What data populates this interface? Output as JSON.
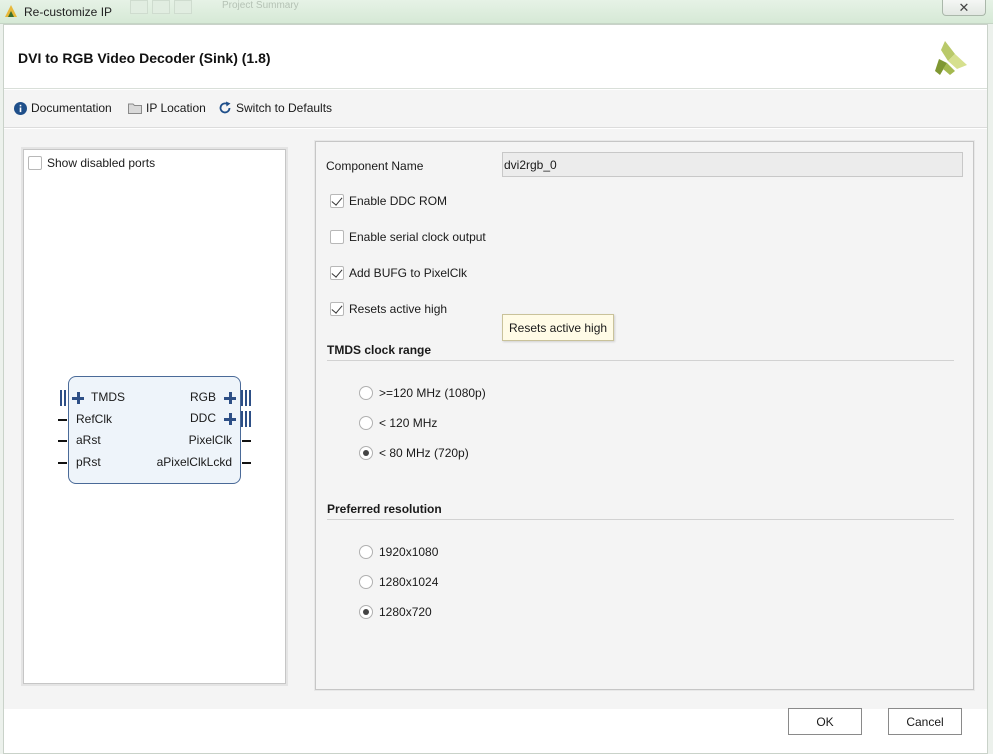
{
  "window": {
    "title": "Re-customize IP",
    "background_tab_text": "Project Summary",
    "close_glyph": "✕"
  },
  "header": {
    "heading": "DVI to RGB Video Decoder (Sink) (1.8)",
    "logo_icon": "xilinx-logo-icon",
    "logo_color": "#8fa33a"
  },
  "toolbar": {
    "documentation": "Documentation",
    "ip_location": "IP Location",
    "switch_defaults": "Switch to Defaults",
    "accent_color": "#1f4f8a"
  },
  "left_panel": {
    "show_disabled_ports": "Show disabled ports",
    "show_disabled_ports_checked": false,
    "block": {
      "left_ports": [
        "TMDS",
        "RefClk",
        "aRst",
        "pRst"
      ],
      "right_ports": [
        "RGB",
        "DDC",
        "PixelClk",
        "aPixelClkLckd"
      ],
      "bus_color": "#2d4f86"
    }
  },
  "form": {
    "component_name_label": "Component Name",
    "component_name_value": "dvi2rgb_0",
    "checkboxes": [
      {
        "label": "Enable DDC ROM",
        "checked": true
      },
      {
        "label": "Enable serial clock output",
        "checked": false
      },
      {
        "label": "Add BUFG to PixelClk",
        "checked": true
      },
      {
        "label": "Resets active high",
        "checked": true
      }
    ],
    "tooltip": "Resets active high",
    "tmds_section": "TMDS clock range",
    "tmds_options": [
      {
        "label": ">=120 MHz (1080p)",
        "selected": false
      },
      {
        "label": "< 120 MHz",
        "selected": false
      },
      {
        "label": "< 80 MHz (720p)",
        "selected": true
      }
    ],
    "resolution_section": "Preferred resolution",
    "resolution_options": [
      {
        "label": "1920x1080",
        "selected": false
      },
      {
        "label": "1280x1024",
        "selected": false
      },
      {
        "label": "1280x720",
        "selected": true
      }
    ]
  },
  "footer": {
    "ok": "OK",
    "cancel": "Cancel"
  }
}
